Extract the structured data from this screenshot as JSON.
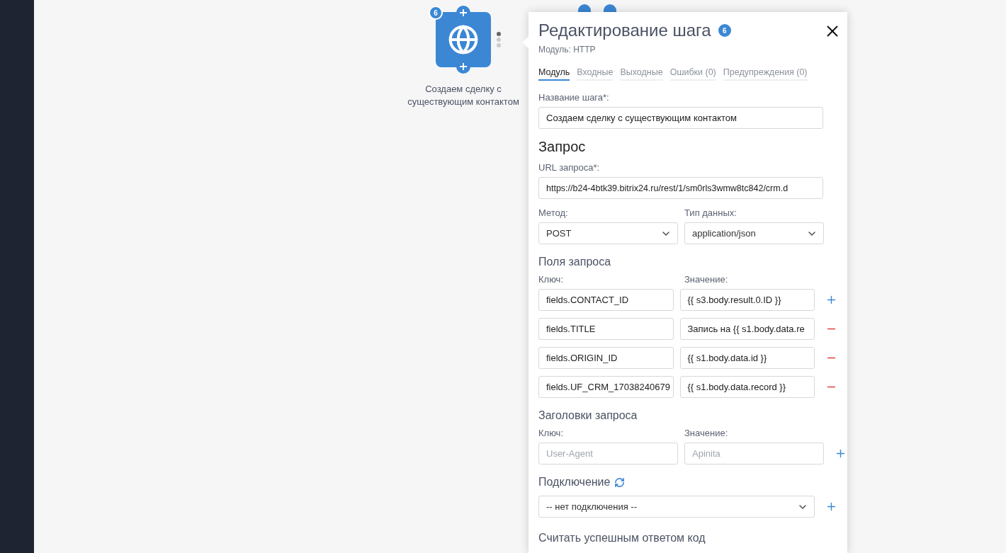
{
  "node": {
    "badge": "6",
    "label": "Создаем сделку с существующим контактом"
  },
  "panel": {
    "title": "Редактирование шага",
    "badge": "6",
    "subtitle": "Модуль: HTTP",
    "tabs": [
      {
        "label": "Модуль",
        "selected": true
      },
      {
        "label": "Входные",
        "selected": false
      },
      {
        "label": "Выходные",
        "selected": false
      },
      {
        "label": "Ошибки (0)",
        "selected": false
      },
      {
        "label": "Предупреждения (0)",
        "selected": false
      }
    ],
    "step_name": {
      "label": "Название шага*:",
      "value": "Создаем сделку с существующим контактом"
    },
    "request": {
      "heading": "Запрос",
      "url": {
        "label": "URL запроса*:",
        "value": "https://b24-4btk39.bitrix24.ru/rest/1/sm0rls3wmw8tc842/crm.d"
      },
      "method": {
        "label": "Метод:",
        "value": "POST"
      },
      "data_type": {
        "label": "Тип данных:",
        "value": "application/json"
      }
    },
    "fields": {
      "heading": "Поля запроса",
      "key_label": "Ключ:",
      "value_label": "Значение:",
      "rows": [
        {
          "key": "fields.CONTACT_ID",
          "value": "{{ s3.body.result.0.ID }}",
          "kind": "add"
        },
        {
          "key": "fields.TITLE",
          "value": "Запись на {{ s1.body.data.re",
          "kind": "remove"
        },
        {
          "key": "fields.ORIGIN_ID",
          "value": "{{ s1.body.data.id }}",
          "kind": "remove"
        },
        {
          "key": "fields.UF_CRM_17038240679",
          "value": "{{ s1.body.data.record }}",
          "kind": "remove"
        }
      ]
    },
    "headers": {
      "heading": "Заголовки запроса",
      "key_label": "Ключ:",
      "value_label": "Значение:",
      "rows": [
        {
          "key_placeholder": "User-Agent",
          "value_placeholder": "Apinita",
          "kind": "add"
        }
      ]
    },
    "connection": {
      "heading": "Подключение",
      "value": "-- нет подключения --"
    },
    "success_code": {
      "heading": "Считать успешным ответом код"
    }
  }
}
